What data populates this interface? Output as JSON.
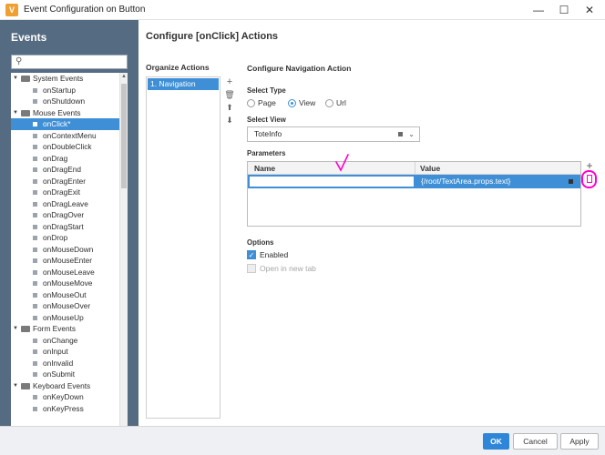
{
  "window": {
    "title": "Event Configuration on Button",
    "app_icon_letter": "V",
    "minimize": "—",
    "maximize": "☐",
    "close": "✕"
  },
  "events_panel": {
    "title": "Events",
    "search_placeholder": "",
    "tree": [
      {
        "label": "System Events",
        "type": "group"
      },
      {
        "label": "onStartup",
        "type": "item"
      },
      {
        "label": "onShutdown",
        "type": "item"
      },
      {
        "label": "Mouse Events",
        "type": "group"
      },
      {
        "label": "onClick*",
        "type": "item",
        "selected": true
      },
      {
        "label": "onContextMenu",
        "type": "item"
      },
      {
        "label": "onDoubleClick",
        "type": "item"
      },
      {
        "label": "onDrag",
        "type": "item"
      },
      {
        "label": "onDragEnd",
        "type": "item"
      },
      {
        "label": "onDragEnter",
        "type": "item"
      },
      {
        "label": "onDragExit",
        "type": "item"
      },
      {
        "label": "onDragLeave",
        "type": "item"
      },
      {
        "label": "onDragOver",
        "type": "item"
      },
      {
        "label": "onDragStart",
        "type": "item"
      },
      {
        "label": "onDrop",
        "type": "item"
      },
      {
        "label": "onMouseDown",
        "type": "item"
      },
      {
        "label": "onMouseEnter",
        "type": "item"
      },
      {
        "label": "onMouseLeave",
        "type": "item"
      },
      {
        "label": "onMouseMove",
        "type": "item"
      },
      {
        "label": "onMouseOut",
        "type": "item"
      },
      {
        "label": "onMouseOver",
        "type": "item"
      },
      {
        "label": "onMouseUp",
        "type": "item"
      },
      {
        "label": "Form Events",
        "type": "group"
      },
      {
        "label": "onChange",
        "type": "item"
      },
      {
        "label": "onInput",
        "type": "item"
      },
      {
        "label": "onInvalid",
        "type": "item"
      },
      {
        "label": "onSubmit",
        "type": "item"
      },
      {
        "label": "Keyboard Events",
        "type": "group"
      },
      {
        "label": "onKeyDown",
        "type": "item"
      },
      {
        "label": "onKeyPress",
        "type": "item"
      }
    ]
  },
  "main": {
    "title": "Configure [onClick] Actions",
    "organize": {
      "title": "Organize Actions",
      "actions": [
        "1. Navigation"
      ]
    },
    "config": {
      "title": "Configure Navigation Action",
      "select_type": {
        "label": "Select Type",
        "options": [
          "Page",
          "View",
          "Url"
        ],
        "selected": "View"
      },
      "select_view": {
        "label": "Select View",
        "value": "ToteInfo"
      },
      "parameters": {
        "label": "Parameters",
        "columns": [
          "Name",
          "Value"
        ],
        "rows": [
          {
            "name": "",
            "value": "{/root/TextArea.props.text}"
          }
        ]
      },
      "options": {
        "label": "Options",
        "enabled_label": "Enabled",
        "enabled": true,
        "new_tab_label": "Open in new tab",
        "new_tab": false
      }
    }
  },
  "footer": {
    "ok": "OK",
    "cancel": "Cancel",
    "apply": "Apply"
  },
  "colors": {
    "selection": "#3f8fd6",
    "sidebar": "#556b82",
    "annotation": "#ff00cc"
  }
}
